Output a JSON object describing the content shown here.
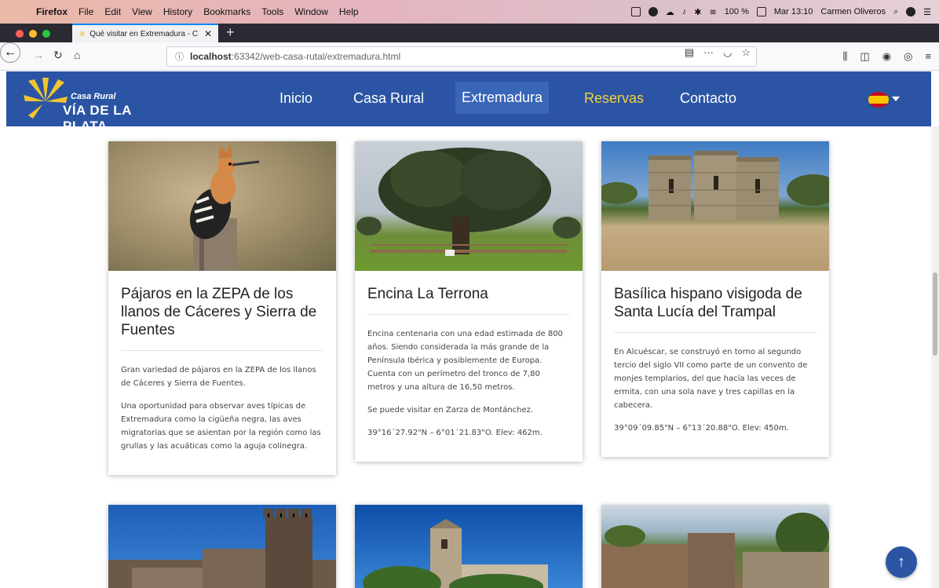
{
  "menubar": {
    "app": "Firefox",
    "items": [
      "File",
      "Edit",
      "View",
      "History",
      "Bookmarks",
      "Tools",
      "Window",
      "Help"
    ],
    "battery": "100 %",
    "clock": "Mar 13:10",
    "user": "Carmen Oliveros"
  },
  "browser": {
    "tab_title": "Qué visitar en Extremadura - C",
    "url_host": "localhost",
    "url_path": ":63342/web-casa-rutal/extremadura.html",
    "url_more": "···"
  },
  "site": {
    "logo_line1": "Casa Rural",
    "logo_line2": "VÍA DE LA PLATA",
    "nav": [
      "Inicio",
      "Casa Rural",
      "Extremadura",
      "Reservas",
      "Contacto"
    ]
  },
  "cards": [
    {
      "title": "Pájaros en la ZEPA de los llanos de Cáceres y Sierra de Fuentes",
      "paragraphs": [
        "Gran variedad de pájaros en la ZEPA de los llanos de Cáceres y Sierra de Fuentes.",
        "Una oportunidad para observar aves típicas de Extremadura como la cigüeña negra, las aves migratorias que se asientan por la región como las grullas y las acuáticas como la aguja colinegra."
      ]
    },
    {
      "title": "Encina La Terrona",
      "paragraphs": [
        "Encina centenaria con una edad estimada de 800 años. Siendo considerada la más grande de la Península Ibérica y posiblemente de Europa. Cuenta con un perímetro del tronco de 7,80 metros y una altura de 16,50 metros.",
        "Se puede visitar en Zarza de Montánchez.",
        "39°16´27.92\"N – 6°01´21.83\"O. Elev: 462m."
      ]
    },
    {
      "title": "Basílica hispano visigoda de Santa Lucía del Trampal",
      "paragraphs": [
        "En Alcuéscar, se construyó en torno al segundo tercio del siglo VII como parte de un convento de monjes templarios, del que hacía las veces de ermita, con una sola nave y tres capillas en la cabecera.",
        "39°09´09.85\"N – 6°13´20.88\"O. Elev: 450m."
      ]
    }
  ],
  "colors": {
    "nav_bg": "#2b55a4",
    "reserve_link": "#f2d13f"
  }
}
